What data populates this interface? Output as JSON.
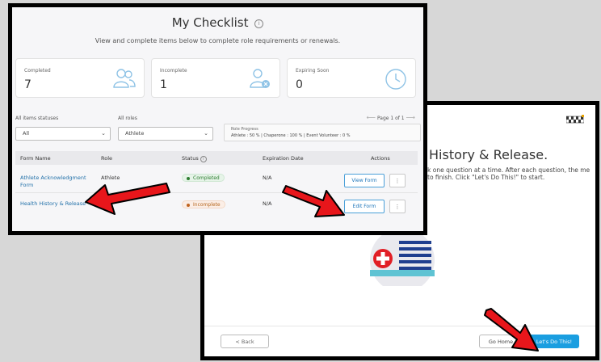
{
  "wizard": {
    "title": "History & Release.",
    "description": "k one question at a time. After each question, the me to finish. Click \"Let's Do This!\" to start.",
    "back_label": "< Back",
    "home_label": "Go Home",
    "do_label": "Let's Do This!"
  },
  "checklist": {
    "title": "My Checklist",
    "info_glyph": "i",
    "subtitle": "View and complete items below to complete role requirements or renewals.",
    "cards": [
      {
        "label": "Completed",
        "value": "7",
        "icon": "people-icon"
      },
      {
        "label": "Incomplete",
        "value": "1",
        "icon": "user-x-icon"
      },
      {
        "label": "Expiring Soon",
        "value": "0",
        "icon": "clock-icon"
      }
    ],
    "filters": {
      "status_label": "All items statuses",
      "status_value": "All",
      "role_label": "All roles",
      "role_value": "Athlete"
    },
    "progress": {
      "title": "Role Progress",
      "values": "Athlete : 50 %  |  Chaperone : 100 %  |  Event Volunteer : 0 %"
    },
    "pager": "Page 1 of 1",
    "columns": [
      "Form Name",
      "Role",
      "Status",
      "Expiration Date",
      "Actions"
    ],
    "rows": [
      {
        "form": "Athlete Acknowledgment",
        "form2": "Form",
        "role": "Athlete",
        "status": "Completed",
        "expiration": "N/A",
        "action": "View Form"
      },
      {
        "form": "Health History & Release",
        "form2": "",
        "role": "",
        "status": "Incomplete",
        "expiration": "N/A",
        "action": "Edit Form"
      }
    ],
    "kebab_glyph": "⋮"
  },
  "colors": {
    "accent": "#1a9ee0",
    "link": "#1f6fa8",
    "arrow": "#e8161b",
    "completed": "#2e7d32",
    "incomplete": "#c0631e"
  }
}
